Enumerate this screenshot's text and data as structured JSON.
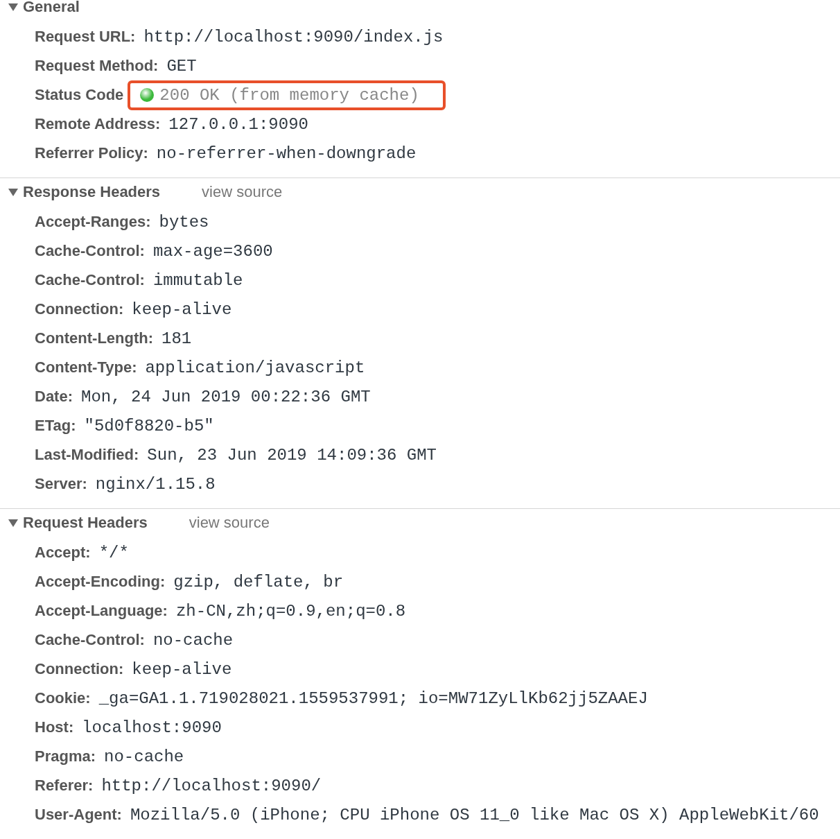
{
  "sections": [
    {
      "title": "General",
      "expanded": true,
      "rows": [
        {
          "kind": "plain",
          "name": "Request URL:",
          "value": "http://localhost:9090/index.js"
        },
        {
          "kind": "plain",
          "name": "Request Method:",
          "value": "GET"
        },
        {
          "kind": "status",
          "name": "Status Code",
          "value": "200 OK (from memory cache)",
          "color": "#3cb93c",
          "highlighted": true
        },
        {
          "kind": "plain",
          "name": "Remote Address:",
          "value": "127.0.0.1:9090"
        },
        {
          "kind": "plain",
          "name": "Referrer Policy:",
          "value": "no-referrer-when-downgrade"
        }
      ]
    },
    {
      "title": "Response Headers",
      "expanded": true,
      "link": "view source",
      "rows": [
        {
          "kind": "plain",
          "name": "Accept-Ranges:",
          "value": "bytes"
        },
        {
          "kind": "plain",
          "name": "Cache-Control:",
          "value": "max-age=3600"
        },
        {
          "kind": "plain",
          "name": "Cache-Control:",
          "value": "immutable"
        },
        {
          "kind": "plain",
          "name": "Connection:",
          "value": "keep-alive"
        },
        {
          "kind": "plain",
          "name": "Content-Length:",
          "value": "181"
        },
        {
          "kind": "plain",
          "name": "Content-Type:",
          "value": "application/javascript"
        },
        {
          "kind": "plain",
          "name": "Date:",
          "value": "Mon, 24 Jun 2019 00:22:36 GMT"
        },
        {
          "kind": "plain",
          "name": "ETag:",
          "value": "\"5d0f8820-b5\""
        },
        {
          "kind": "plain",
          "name": "Last-Modified:",
          "value": "Sun, 23 Jun 2019 14:09:36 GMT"
        },
        {
          "kind": "plain",
          "name": "Server:",
          "value": "nginx/1.15.8"
        }
      ]
    },
    {
      "title": "Request Headers",
      "expanded": true,
      "link": "view source",
      "rows": [
        {
          "kind": "plain",
          "name": "Accept:",
          "value": "*/*"
        },
        {
          "kind": "plain",
          "name": "Accept-Encoding:",
          "value": "gzip, deflate, br"
        },
        {
          "kind": "plain",
          "name": "Accept-Language:",
          "value": "zh-CN,zh;q=0.9,en;q=0.8"
        },
        {
          "kind": "plain",
          "name": "Cache-Control:",
          "value": "no-cache"
        },
        {
          "kind": "plain",
          "name": "Connection:",
          "value": "keep-alive"
        },
        {
          "kind": "plain",
          "name": "Cookie:",
          "value": "_ga=GA1.1.719028021.1559537991; io=MW71ZyLlKb62jj5ZAAEJ"
        },
        {
          "kind": "plain",
          "name": "Host:",
          "value": "localhost:9090"
        },
        {
          "kind": "plain",
          "name": "Pragma:",
          "value": "no-cache"
        },
        {
          "kind": "plain",
          "name": "Referer:",
          "value": "http://localhost:9090/"
        },
        {
          "kind": "plain",
          "name": "User-Agent:",
          "value": "Mozilla/5.0 (iPhone; CPU iPhone OS 11_0 like Mac OS X) AppleWebKit/60"
        }
      ]
    }
  ]
}
